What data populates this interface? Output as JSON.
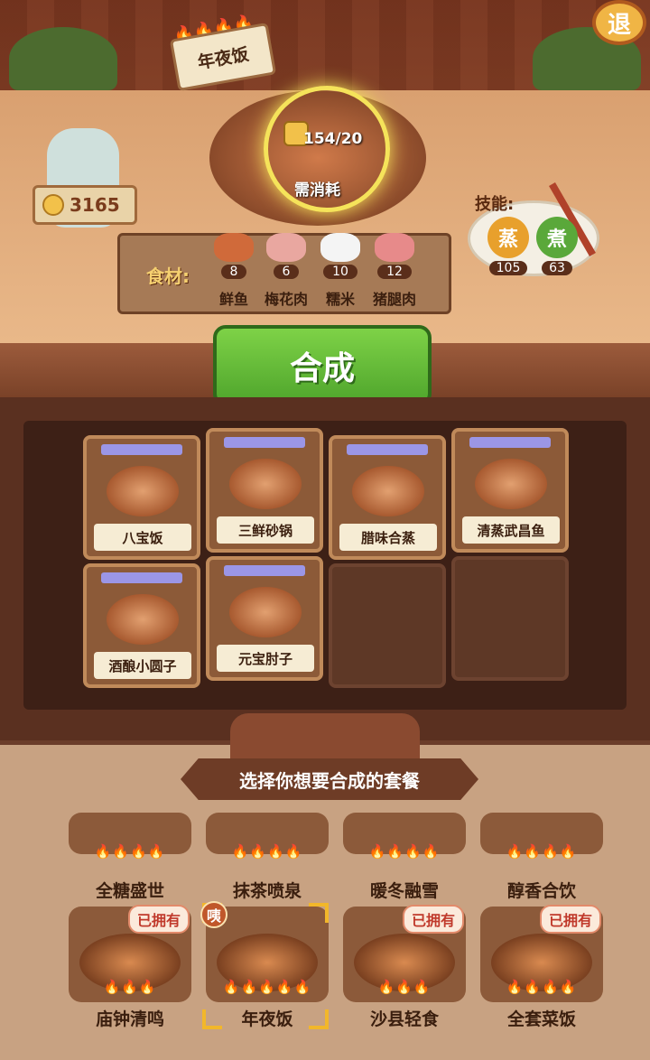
{
  "header": {
    "sign_title": "年夜饭",
    "sign_flames": "🔥🔥🔥🔥",
    "exit_label": "退"
  },
  "coins": {
    "value": "3165"
  },
  "cost": {
    "progress": "154/20",
    "label": "需消耗"
  },
  "ingredients": {
    "label": "食材:",
    "items": [
      {
        "name": "鲜鱼",
        "count": "8",
        "color": "#d06a3a"
      },
      {
        "name": "梅花肉",
        "count": "6",
        "color": "#e9a7a0"
      },
      {
        "name": "糯米",
        "count": "10",
        "color": "#f4f4f4"
      },
      {
        "name": "猪腿肉",
        "count": "12",
        "color": "#e78a8a"
      }
    ]
  },
  "skills": {
    "label": "技能:",
    "items": [
      {
        "name": "蒸",
        "value": "105",
        "color": "#e8a02c"
      },
      {
        "name": "煮",
        "value": "63",
        "color": "#5aa83a"
      }
    ]
  },
  "synth_button": {
    "label": "合成"
  },
  "dishes": [
    {
      "name": "八宝饭"
    },
    {
      "name": "三鲜砂锅"
    },
    {
      "name": "腊味合蒸"
    },
    {
      "name": "清蒸武昌鱼"
    },
    {
      "name": "酒酿小圆子"
    },
    {
      "name": "元宝肘子"
    }
  ],
  "selector": {
    "banner": "选择你想要合成的套餐",
    "selected_badge": "咦",
    "row1": [
      {
        "name": "全糖盛世",
        "flames": "🔥🔥🔥🔥"
      },
      {
        "name": "抹茶喷泉",
        "flames": "🔥🔥🔥🔥"
      },
      {
        "name": "暖冬融雪",
        "flames": "🔥🔥🔥🔥"
      },
      {
        "name": "醇香合饮",
        "flames": "🔥🔥🔥🔥"
      }
    ],
    "row2": [
      {
        "name": "庙钟清鸣",
        "flames": "🔥🔥🔥",
        "owned": "已拥有"
      },
      {
        "name": "年夜饭",
        "flames": "🔥🔥🔥🔥🔥",
        "owned": ""
      },
      {
        "name": "沙县轻食",
        "flames": "🔥🔥🔥",
        "owned": "已拥有"
      },
      {
        "name": "全套菜饭",
        "flames": "🔥🔥🔥🔥",
        "owned": "已拥有"
      }
    ]
  }
}
